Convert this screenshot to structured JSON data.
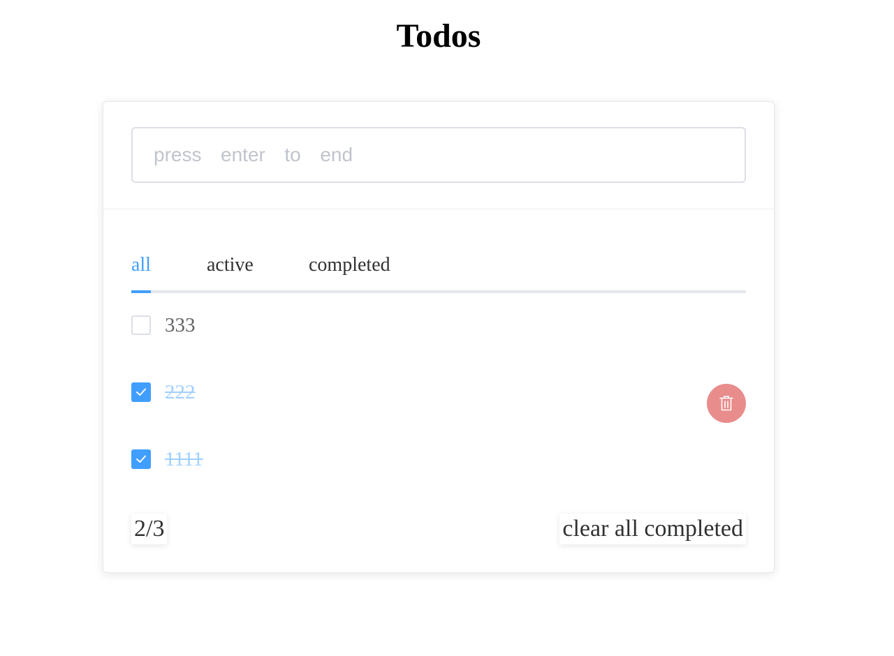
{
  "page": {
    "title": "Todos"
  },
  "input": {
    "placeholder": "press  enter  to  end",
    "value": ""
  },
  "tabs": [
    {
      "label": "all",
      "active": true
    },
    {
      "label": "active",
      "active": false
    },
    {
      "label": "completed",
      "active": false
    }
  ],
  "todos": [
    {
      "text": "333",
      "completed": false
    },
    {
      "text": "222",
      "completed": true,
      "hovered": true
    },
    {
      "text": "1111",
      "completed": true
    }
  ],
  "footer": {
    "count": "2/3",
    "clear_label": "clear all completed"
  },
  "icons": {
    "checkbox_check": "check-icon",
    "delete": "trash-icon"
  },
  "colors": {
    "accent": "#409eff",
    "completed_text": "#a0cfff",
    "delete_button": "#e88c8c",
    "border": "#dcdfe6"
  }
}
